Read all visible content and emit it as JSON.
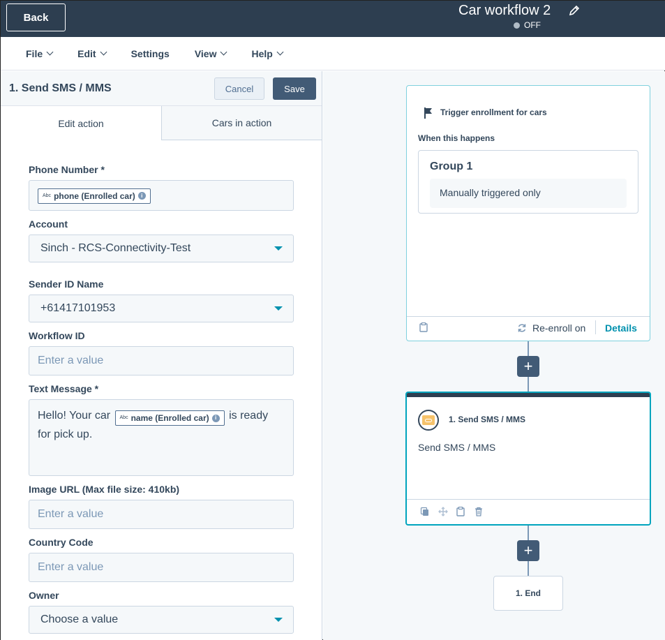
{
  "header": {
    "back_label": "Back",
    "title": "Car workflow 2",
    "status": "OFF"
  },
  "menu": {
    "items": [
      "File",
      "Edit",
      "Settings",
      "View",
      "Help"
    ]
  },
  "panel": {
    "title": "1. Send SMS / MMS",
    "cancel_label": "Cancel",
    "save_label": "Save",
    "tabs": [
      "Edit action",
      "Cars in action"
    ]
  },
  "form": {
    "phone_label": "Phone Number *",
    "phone_token": "phone (Enrolled car)",
    "token_type": "Abc",
    "account_label": "Account",
    "account_value": "Sinch - RCS-Connectivity-Test",
    "sender_label": "Sender ID Name",
    "sender_value": "+61417101953",
    "workflow_label": "Workflow ID",
    "workflow_placeholder": "Enter a value",
    "message_label": "Text Message *",
    "message_pre": "Hello! Your car",
    "message_token": "name (Enrolled car)",
    "message_post": "is ready",
    "message_line2": "for pick up.",
    "image_label": "Image URL (Max file size: 410kb)",
    "image_placeholder": "Enter a value",
    "country_label": "Country Code",
    "country_placeholder": "Enter a value",
    "owner_label": "Owner",
    "owner_placeholder": "Choose a value"
  },
  "canvas": {
    "trigger": {
      "title": "Trigger enrollment for cars",
      "when_label": "When this happens",
      "group_title": "Group 1",
      "group_condition": "Manually triggered only",
      "reenroll_label": "Re-enroll on",
      "details_label": "Details"
    },
    "action": {
      "title": "1. Send SMS / MMS",
      "body": "Send SMS / MMS"
    },
    "end_label": "1. End",
    "plus_label": "+"
  },
  "colors": {
    "header_bg": "#2d3e50",
    "accent": "#00a4bd",
    "link": "#0091ae",
    "button": "#425b76"
  }
}
